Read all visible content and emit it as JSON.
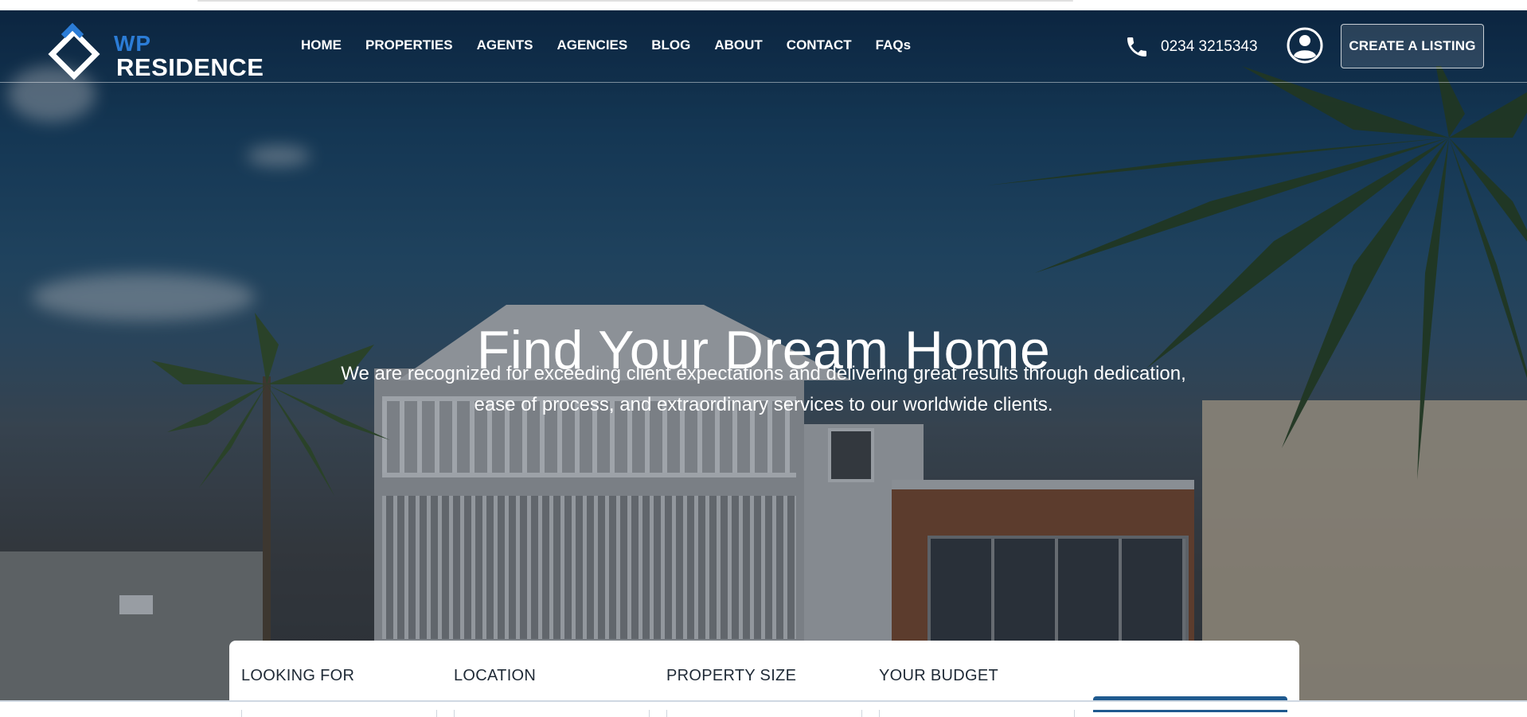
{
  "brand": {
    "line1": "WP",
    "line2": "RESIDENCE"
  },
  "nav": {
    "items": [
      {
        "label": "HOME"
      },
      {
        "label": "PROPERTIES"
      },
      {
        "label": "AGENTS"
      },
      {
        "label": "AGENCIES"
      },
      {
        "label": "BLOG"
      },
      {
        "label": "ABOUT"
      },
      {
        "label": "CONTACT"
      },
      {
        "label": "FAQs"
      }
    ]
  },
  "header": {
    "phone_icon": "phone-icon",
    "phone": "0234 3215343",
    "user_icon": "user-icon",
    "cta": "CREATE A LISTING"
  },
  "hero": {
    "title": "Find Your Dream Home",
    "subtitle_line1": "We are recognized for exceeding client expectations and delivering great results through dedication,",
    "subtitle_line2": "ease of process, and extraordinary services to our worldwide clients."
  },
  "search": {
    "fields": [
      {
        "label": "LOOKING FOR"
      },
      {
        "label": "LOCATION"
      },
      {
        "label": "PROPERTY SIZE"
      },
      {
        "label": "YOUR BUDGET"
      }
    ]
  },
  "colors": {
    "brand_blue": "#2b7cd6",
    "button_blue": "#1f5a8f",
    "text_dark": "#1f2a36"
  }
}
